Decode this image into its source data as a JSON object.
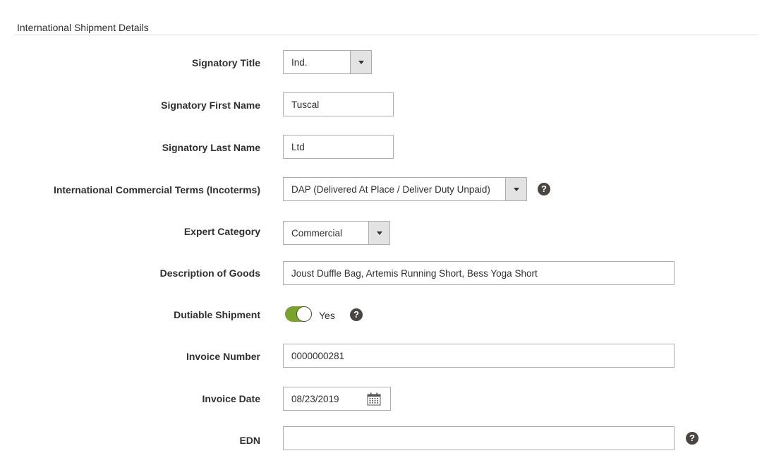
{
  "section": {
    "title": "International Shipment Details"
  },
  "fields": {
    "signatory_title": {
      "label": "Signatory Title",
      "value": "Ind."
    },
    "signatory_first_name": {
      "label": "Signatory First Name",
      "value": "Tuscal"
    },
    "signatory_last_name": {
      "label": "Signatory Last Name",
      "value": "Ltd"
    },
    "incoterms": {
      "label": "International Commercial Terms (Incoterms)",
      "value": "DAP (Delivered At Place / Deliver Duty Unpaid)"
    },
    "export_category": {
      "label": "Expert Category",
      "value": "Commercial"
    },
    "description": {
      "label": "Description of Goods",
      "value": "Joust Duffle Bag, Artemis Running Short, Bess Yoga Short"
    },
    "dutiable": {
      "label": "Dutiable Shipment",
      "value": "Yes",
      "on": true
    },
    "invoice_number": {
      "label": "Invoice Number",
      "value": "0000000281"
    },
    "invoice_date": {
      "label": "Invoice Date",
      "value": "08/23/2019"
    },
    "edn": {
      "label": "EDN",
      "value": ""
    }
  },
  "icons": {
    "help": "question-mark-icon",
    "calendar": "calendar-icon",
    "dropdown": "caret-down-icon"
  },
  "colors": {
    "toggle_on": "#79a22e",
    "help_icon": "#4a4542",
    "border": "#adadad",
    "select_button": "#e3e3e3"
  }
}
